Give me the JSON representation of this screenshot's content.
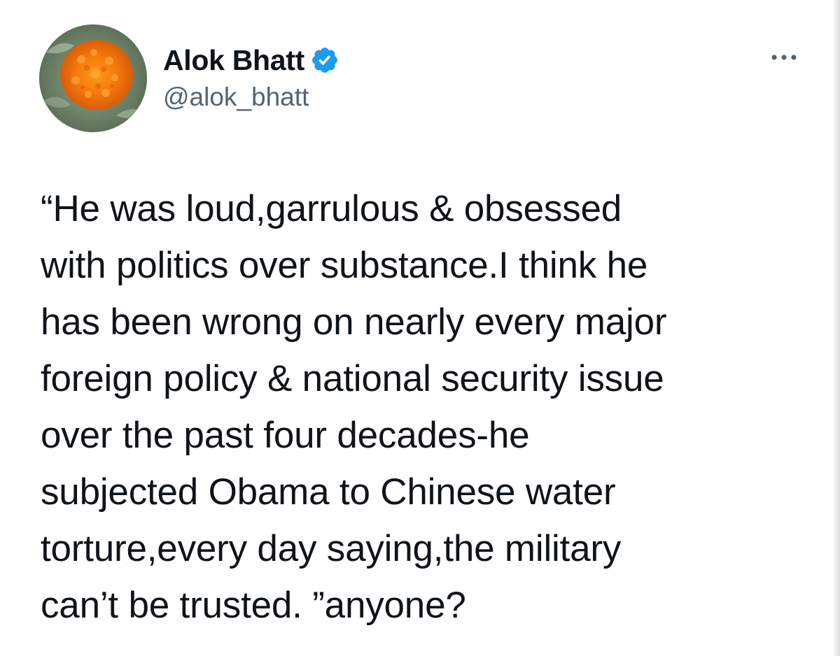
{
  "tweet": {
    "author": {
      "display_name": "Alok Bhatt",
      "handle": "@alok_bhatt",
      "verified": true,
      "avatar_icon": "marigold-flower-avatar"
    },
    "menu_icon": "more-horizontal-icon",
    "text_lines": [
      "“He was loud,garrulous & obsessed",
      "with politics over substance.I think he",
      "has been wrong on nearly every major",
      "foreign policy & national security issue",
      "over the past four decades-he",
      "subjected Obama to Chinese water",
      "torture,every day saying,the military",
      "can’t be trusted. ”anyone?"
    ]
  },
  "colors": {
    "text": "#0f1419",
    "secondary_text": "#536471",
    "verified_blue": "#1d9bf0",
    "background": "#ffffff"
  }
}
